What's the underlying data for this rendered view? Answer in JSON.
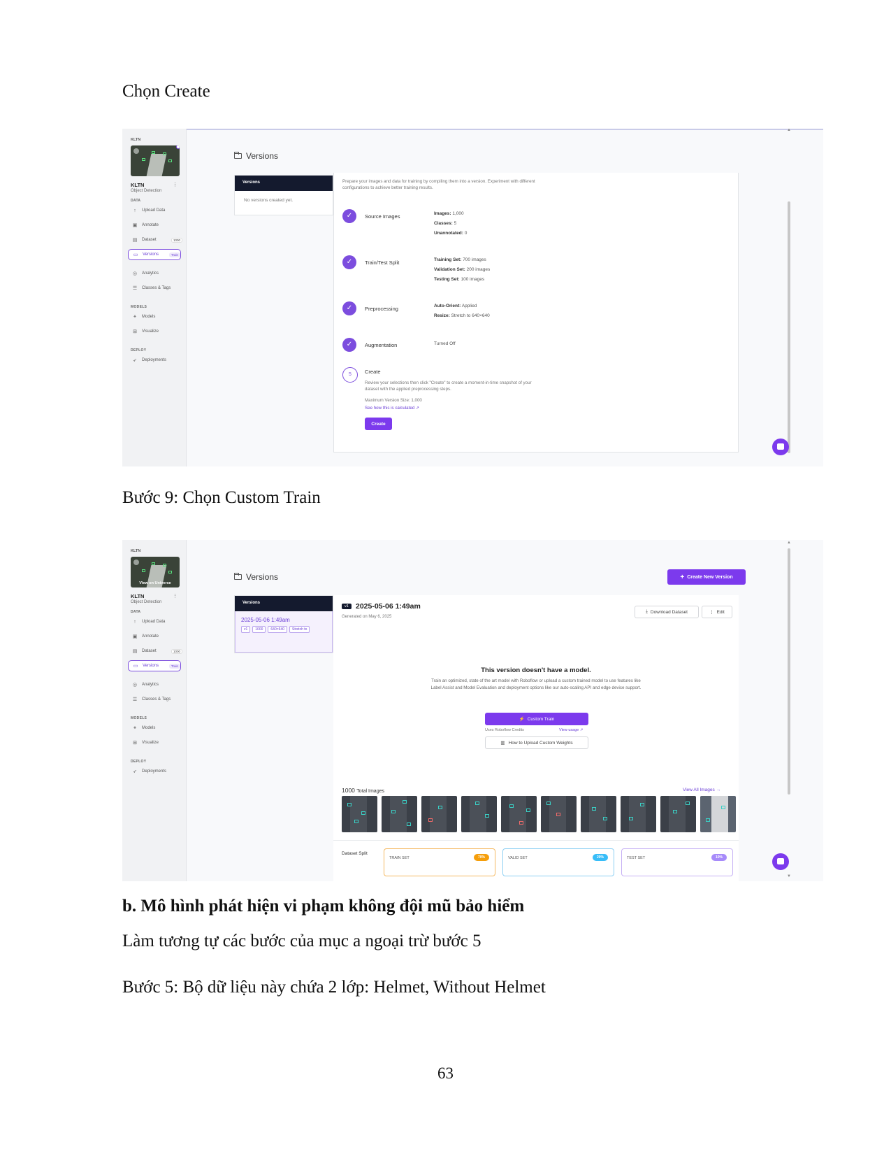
{
  "doc": {
    "caption1": "Chọn Create",
    "caption2": "Bước 9: Chọn Custom Train",
    "heading_b": "b. Mô hình phát hiện vi phạm không đội mũ bảo hiểm",
    "para1": "Làm tương tự các bước của mục a ngoại trừ bước 5",
    "para2": "Bước 5: Bộ dữ liệu này chứa 2 lớp: Helmet, Without Helmet",
    "page_number": "63"
  },
  "sidebar": {
    "project_label": "KLTN",
    "project_name": "KLTN",
    "project_type": "Object Detection",
    "more": "⋮",
    "thumb_overlay": "View on Universe",
    "sections": {
      "data": "DATA",
      "models": "MODELS",
      "deploy": "DEPLOY"
    },
    "items": {
      "upload": "Upload Data",
      "annotate": "Annotate",
      "dataset": "Dataset",
      "dataset_badge": "1000",
      "versions": "Versions",
      "versions_badge": "Train",
      "analytics": "Analytics",
      "classes": "Classes & Tags",
      "models": "Models",
      "visualize": "Visualize",
      "deployments": "Deployments"
    }
  },
  "shot1": {
    "title": "Versions",
    "versions_panel_header": "Versions",
    "no_versions": "No versions created yet.",
    "intro": "Prepare your images and data for training by compiling them into a version. Experiment with different configurations to achieve better training results.",
    "steps": {
      "source": {
        "name": "Source Images",
        "images_label": "Images:",
        "images_value": "1,000",
        "classes_label": "Classes:",
        "classes_value": "5",
        "unannotated_label": "Unannotated:",
        "unannotated_value": "0"
      },
      "split": {
        "name": "Train/Test Split",
        "training_label": "Training Set:",
        "training_value": "700 images",
        "validation_label": "Validation Set:",
        "validation_value": "200 images",
        "testing_label": "Testing Set:",
        "testing_value": "100 images"
      },
      "preprocessing": {
        "name": "Preprocessing",
        "orient_label": "Auto-Orient:",
        "orient_value": "Applied",
        "resize_label": "Resize:",
        "resize_value": "Stretch to 640×640"
      },
      "augmentation": {
        "name": "Augmentation",
        "value": "Turned Off"
      },
      "create": {
        "number": "5",
        "name": "Create",
        "desc": "Review your selections then click \"Create\" to create a moment-in-time snapshot of your dataset with the applied preprocessing steps.",
        "max_size": "Maximum Version Size: 1,000",
        "link": "See how this is calculated ↗",
        "button": "Create"
      }
    }
  },
  "shot2": {
    "title": "Versions",
    "create_new_version": "Create New Version",
    "versions_panel_header": "Versions",
    "version_item": {
      "title": "2025-05-06 1:49am",
      "chips": [
        "v1",
        "1000",
        "640×640",
        "Stretch to"
      ]
    },
    "version": {
      "badge": "v1",
      "title": "2025-05-06 1:49am",
      "generated": "Generated on May 6, 2025",
      "download": "Download Dataset",
      "edit": "Edit"
    },
    "no_model": {
      "title": "This version doesn't have a model.",
      "desc": "Train an optimized, state of the art model with Roboflow or upload a custom trained model to use features like Label Assist and Model Evaluation and deployment options like our auto-scaling API and edge device support.",
      "custom_train": "Custom Train",
      "credits": "Uses Roboflow Credits",
      "view_usage": "View usage ↗",
      "upload_weights": "How to Upload Custom Weights"
    },
    "images": {
      "count": "1000",
      "label": "Total Images",
      "view_all": "View All Images →"
    },
    "split": {
      "label": "Dataset Split",
      "train_name": "TRAIN SET",
      "train_pct": "70%",
      "valid_name": "VALID SET",
      "valid_pct": "20%",
      "test_name": "TEST SET",
      "test_pct": "10%"
    }
  },
  "colors": {
    "accent": "#7c3aed",
    "panel_header": "#141a2e",
    "train": "#f59e0b",
    "valid": "#38bdf8",
    "test": "#a78bfa"
  }
}
